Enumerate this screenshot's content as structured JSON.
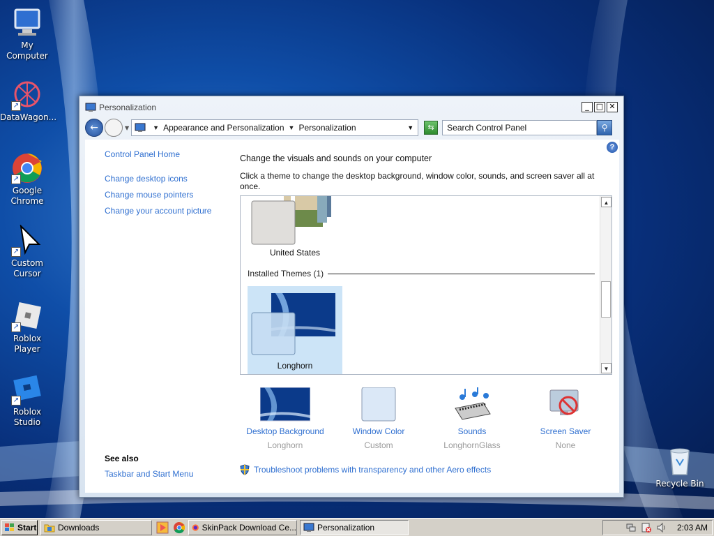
{
  "desktop": {
    "icons": [
      {
        "label": "My Computer"
      },
      {
        "label": "DataWagon..."
      },
      {
        "label": "Google Chrome"
      },
      {
        "label": "Custom Cursor"
      },
      {
        "label": "Roblox Player"
      },
      {
        "label": "Roblox Studio"
      },
      {
        "label": "Recycle Bin"
      }
    ]
  },
  "window": {
    "title": "Personalization",
    "controls": {
      "minimize": "_",
      "maximize": "□",
      "close": "✕"
    },
    "address": {
      "crumb1": "Appearance and Personalization",
      "crumb2": "Personalization",
      "search_placeholder": "Search Control Panel"
    },
    "sidebar": {
      "home": "Control Panel Home",
      "links": [
        "Change desktop icons",
        "Change mouse pointers",
        "Change your account picture"
      ],
      "see_also_title": "See also",
      "see_also_link": "Taskbar and Start Menu"
    },
    "main": {
      "heading": "Change the visuals and sounds on your computer",
      "subtext": "Click a theme to change the desktop background, window color, sounds, and screen saver all at once.",
      "themes": {
        "partial_theme_name": "United States",
        "group_header": "Installed Themes (1)",
        "selected_theme_name": "Longhorn"
      },
      "bottom_items": [
        {
          "label": "Desktop Background",
          "value": "Longhorn"
        },
        {
          "label": "Window Color",
          "value": "Custom"
        },
        {
          "label": "Sounds",
          "value": "LonghornGlass"
        },
        {
          "label": "Screen Saver",
          "value": "None"
        }
      ],
      "troubleshoot": "Troubleshoot problems with transparency and other Aero effects"
    }
  },
  "taskbar": {
    "start": "Start",
    "tasks": [
      "Downloads",
      "SkinPack Download Ce...",
      "Personalization"
    ],
    "clock": "2:03 AM"
  }
}
